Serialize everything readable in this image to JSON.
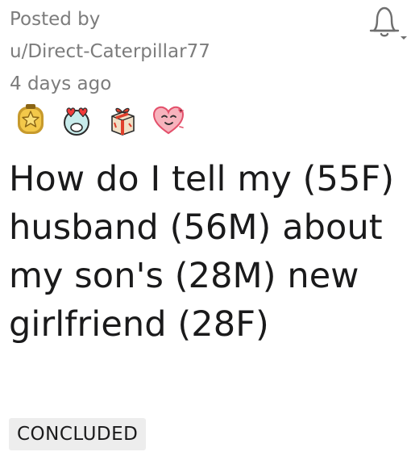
{
  "post": {
    "posted_by_label": "Posted by",
    "author": "u/Direct-Caterpillar77",
    "age": "4 days ago",
    "title": "How do I tell my (55F) husband (56M) about my son's (28M) new girlfriend (28F)",
    "flair": "CONCLUDED"
  },
  "awards": [
    {
      "icon": "medal-icon"
    },
    {
      "icon": "heart-eyes-icon"
    },
    {
      "icon": "gift-icon"
    },
    {
      "icon": "heart-face-icon"
    }
  ],
  "notify": {
    "icon": "bell-icon"
  },
  "colors": {
    "meta_text": "#7c7c7c",
    "title_text": "#1a1a1b",
    "flair_bg": "#ededed"
  }
}
